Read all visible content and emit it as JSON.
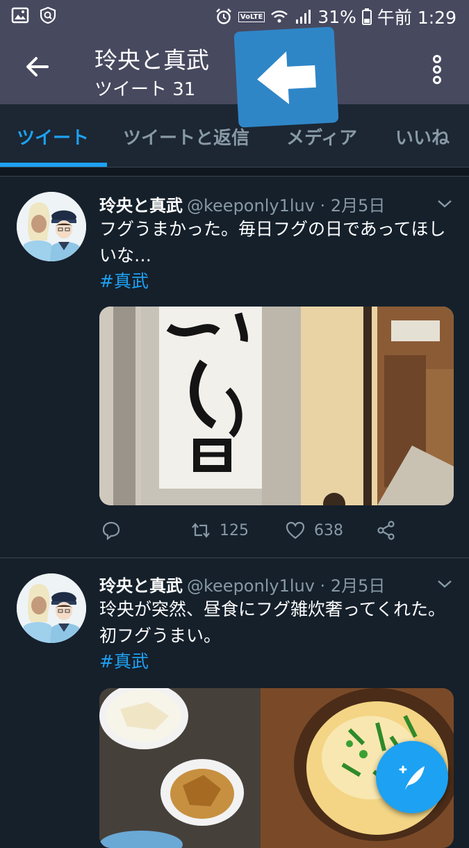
{
  "status_bar": {
    "battery": "31%",
    "time": "午前 1:29",
    "network_badge": "VoLTE",
    "icons": [
      "gallery-icon",
      "shield-icon",
      "alarm-icon",
      "wifi-icon",
      "signal-icon",
      "battery-icon"
    ]
  },
  "header": {
    "title": "玲央と真武",
    "subtitle": "ツイート 31"
  },
  "tabs": [
    {
      "label": "ツイート",
      "active": true
    },
    {
      "label": "ツイートと返信",
      "active": false
    },
    {
      "label": "メディア",
      "active": false
    },
    {
      "label": "いいね",
      "active": false
    }
  ],
  "tweets": [
    {
      "name": "玲央と真武",
      "meta": "@keeponly1luv · 2月5日",
      "text": "フグうまかった。毎日フグの日であってほしいな…",
      "hashtag": "#真武",
      "retweets": "125",
      "likes": "638"
    },
    {
      "name": "玲央と真武",
      "meta": "@keeponly1luv · 2月5日",
      "text": "玲央が突然、昼食にフグ雑炊奢ってくれた。初フグうまい。",
      "hashtag": "#真武"
    }
  ],
  "colors": {
    "accent": "#1da1f2",
    "background": "#15202b",
    "header": "#47495f",
    "overlay_arrow_box": "#2f86c7"
  }
}
